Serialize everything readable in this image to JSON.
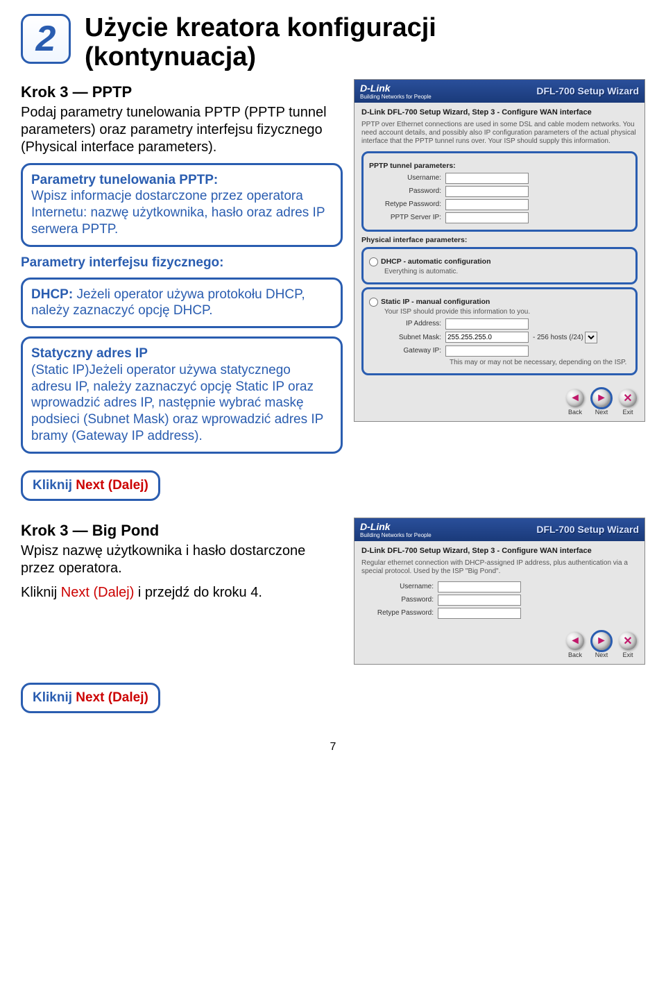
{
  "badge_number": "2",
  "main_title_line1": "Użycie kreatora konfiguracji",
  "main_title_line2": "(kontynuacja)",
  "step3_pptp": {
    "title": "Krok 3 — PPTP",
    "desc": "Podaj parametry tunelowania PPTP (PPTP tunnel parameters) oraz parametry interfejsu fizycznego (Physical interface parameters)."
  },
  "callout_pptp": {
    "bold": "Parametry tunelowania PPTP:",
    "text": "Wpisz informacje dostarczone przez operatora Internetu: nazwę użytkownika, hasło oraz adres IP serwera PPTP."
  },
  "phys_label": "Parametry interfejsu fizycznego:",
  "callout_dhcp": {
    "bold": "DHCP:",
    "text": " Jeżeli operator używa protokołu DHCP, należy zaznaczyć opcję DHCP."
  },
  "callout_static": {
    "bold": "Statyczny adres IP",
    "text": "(Static IP)Jeżeli operator używa statycznego adresu IP, należy zaznaczyć opcję Static IP oraz wprowadzić adres IP, następnie wybrać maskę podsieci (Subnet Mask) oraz wprowadzić adres IP bramy (Gateway IP address)."
  },
  "click_next_prefix": "Kliknij ",
  "click_next_red": "Next (Dalej)",
  "step3_bigpond": {
    "title": "Krok 3 — Big Pond",
    "line1": "Wpisz nazwę użytkownika i hasło dostarczone przez operatora.",
    "line2_pre": "Kliknij ",
    "line2_red": "Next (Dalej)",
    "line2_post": " i przejdź do kroku 4."
  },
  "wizard_common": {
    "logo": "D-Link",
    "logo_sub": "Building Networks for People",
    "banner": "DFL-700 Setup Wizard",
    "back": "Back",
    "next": "Next",
    "exit": "Exit"
  },
  "wizard1": {
    "step_title": "D-Link DFL-700 Setup Wizard, Step 3 - Configure WAN interface",
    "note": "PPTP over Ethernet connections are used in some DSL and cable modem networks. You need account details, and possibly also IP configuration parameters of the actual physical interface that the PPTP tunnel runs over. Your ISP should supply this information.",
    "tunnel_label": "PPTP tunnel parameters:",
    "username_lbl": "Username:",
    "password_lbl": "Password:",
    "retype_lbl": "Retype Password:",
    "server_lbl": "PPTP Server IP:",
    "phys_label": "Physical interface parameters:",
    "dhcp_label": "DHCP - automatic configuration",
    "dhcp_note": "Everything is automatic.",
    "static_label": "Static IP - manual configuration",
    "static_note": "Your ISP should provide this information to you.",
    "ip_lbl": "IP Address:",
    "subnet_lbl": "Subnet Mask:",
    "subnet_val": "255.255.255.0",
    "subnet_after": "- 256 hosts (/24)",
    "gateway_lbl": "Gateway IP:",
    "gateway_note": "This may or may not be necessary, depending on the ISP."
  },
  "wizard2": {
    "step_title": "D-Link DFL-700 Setup Wizard, Step 3 - Configure WAN interface",
    "note": "Regular ethernet connection with DHCP-assigned IP address, plus authentication via a special protocol. Used by the ISP \"Big Pond\".",
    "username_lbl": "Username:",
    "password_lbl": "Password:",
    "retype_lbl": "Retype Password:"
  },
  "page_number": "7"
}
